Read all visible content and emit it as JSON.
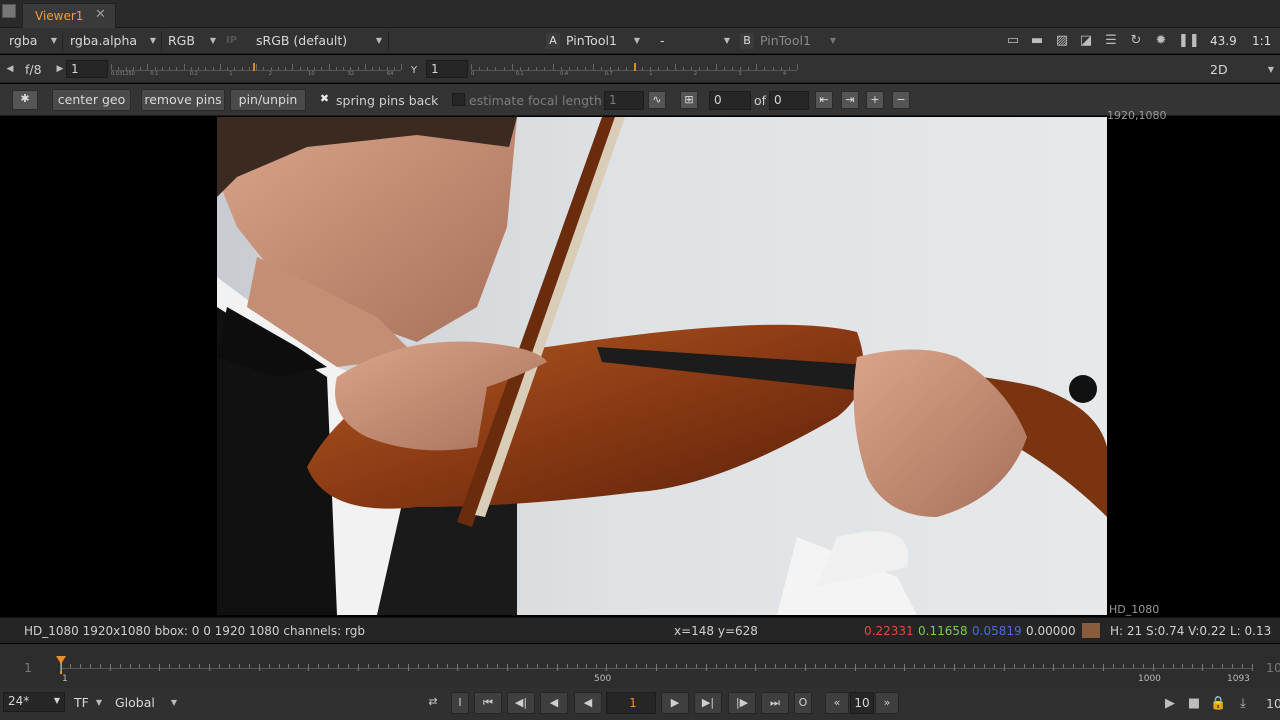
{
  "tab": {
    "title": "Viewer1",
    "close": "✕"
  },
  "toolbar": {
    "channels": "rgba",
    "alpha": "rgba.alpha",
    "display": "RGB",
    "ip": "IP",
    "lut": "sRGB (default)",
    "input_a_label": "A",
    "input_a": "PinTool1",
    "compare": "-",
    "input_b_label": "B",
    "input_b": "PinTool1",
    "zoom": "43.9",
    "ratio": "1:1"
  },
  "row2": {
    "fstop": "f/8",
    "gain": "1",
    "gain_ticks": [
      "0.031250",
      "0.1",
      "0.2",
      "1",
      "2",
      "10",
      "32",
      "64"
    ],
    "y_label": "Y",
    "gamma": "1",
    "gamma_ticks": [
      "0",
      "0.1",
      "0.4",
      "0.7",
      "1",
      "2",
      "3",
      "4"
    ],
    "view_mode": "2D"
  },
  "pins": {
    "center_geo": "center geo",
    "remove_pins": "remove pins",
    "pin_unpin": "pin/unpin",
    "spring_check": "✖",
    "spring_label": "spring pins back",
    "estimate_label": "estimate focal length",
    "estimate_value": "1",
    "frame_value": "0",
    "of_label": "of",
    "of_value": "0"
  },
  "viewer": {
    "format_top": "1920,1080",
    "format_bottom": "HD_1080"
  },
  "info": {
    "format": "HD_1080 1920x1080  bbox: 0 0 1920 1080 channels: rgb",
    "coords": "x=148 y=628",
    "r": "0.22331",
    "g": "0.11658",
    "b": "0.05819",
    "a": "0.00000",
    "hsv": "H: 21 S:0.74 V:0.22  L: 0.13",
    "colors": {
      "r": "#e04a3a",
      "g": "#7ad04a",
      "b": "#4a6ae0",
      "a": "#d0d0d0",
      "swatch": "#8a5c3e"
    }
  },
  "timeline": {
    "left_frame": "1",
    "labels": [
      "1",
      "500",
      "1000",
      "1093"
    ],
    "right_frame": "10"
  },
  "transport": {
    "fps": "24*",
    "tf": "TF",
    "global": "Global",
    "in_mark": "I",
    "frame": "1",
    "out_mark": "O",
    "step": "10",
    "right_num": "10"
  }
}
